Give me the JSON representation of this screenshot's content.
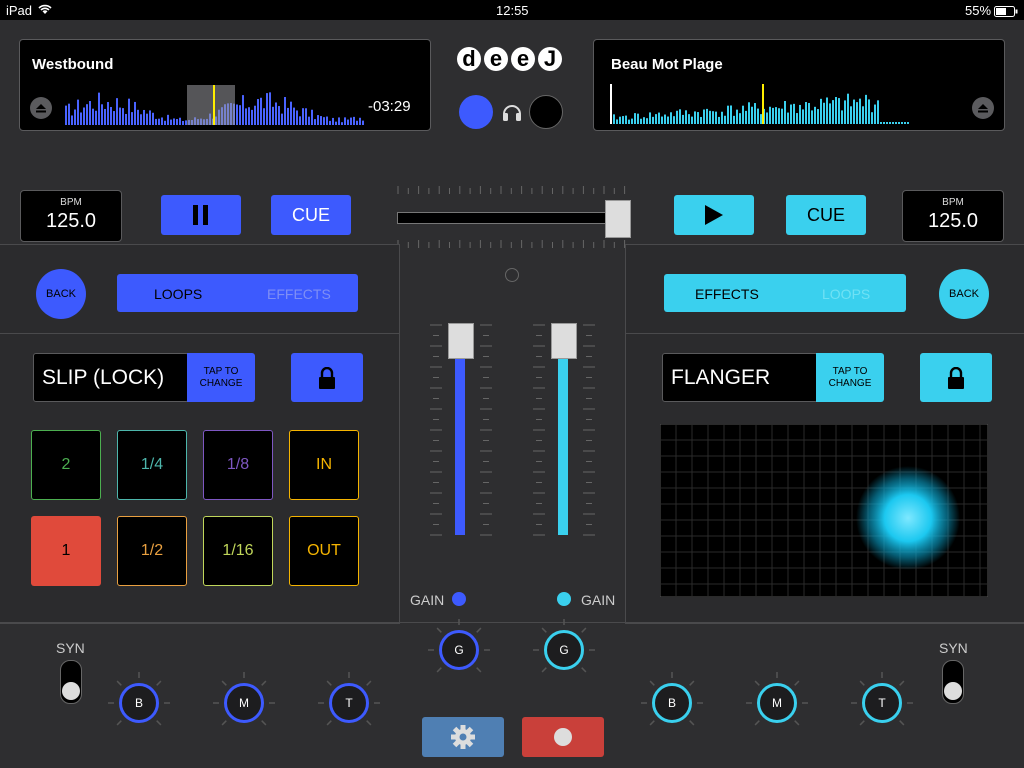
{
  "status": {
    "device": "iPad",
    "time": "12:55",
    "battery": "55%"
  },
  "app": {
    "logo": [
      "d",
      "e",
      "e",
      "J"
    ]
  },
  "deck_a": {
    "title": "Westbound",
    "remaining": "-03:29",
    "bpm_label": "BPM",
    "bpm": "125.0",
    "cue": "CUE",
    "back": "BACK",
    "tab_active": "LOOPS",
    "tab_inactive": "EFFECTS",
    "fx_name": "SLIP (LOCK)",
    "tap_label": "TAP TO CHANGE",
    "pads_row1": [
      "2",
      "1/4",
      "1/8",
      "IN"
    ],
    "pads_row2": [
      "1",
      "1/2",
      "1/16",
      "OUT"
    ],
    "syn": "SYN",
    "knobs": [
      "B",
      "M",
      "T"
    ],
    "color": "#3d5afe"
  },
  "deck_b": {
    "title": "Beau Mot Plage",
    "bpm_label": "BPM",
    "bpm": "125.0",
    "cue": "CUE",
    "back": "BACK",
    "tab_active": "EFFECTS",
    "tab_inactive": "LOOPS",
    "fx_name": "FLANGER",
    "tap_label": "TAP TO CHANGE",
    "syn": "SYN",
    "knobs": [
      "B",
      "M",
      "T"
    ],
    "color": "#3ad0ee"
  },
  "mixer": {
    "gain_left": "GAIN",
    "gain_right": "GAIN",
    "gain_knob_left": "G",
    "gain_knob_right": "G",
    "crossfader_position": 1.0
  },
  "icons": [
    "eject-icon",
    "headphones-icon",
    "pause-icon",
    "play-icon",
    "lock-icon",
    "gear-icon",
    "record-icon"
  ]
}
